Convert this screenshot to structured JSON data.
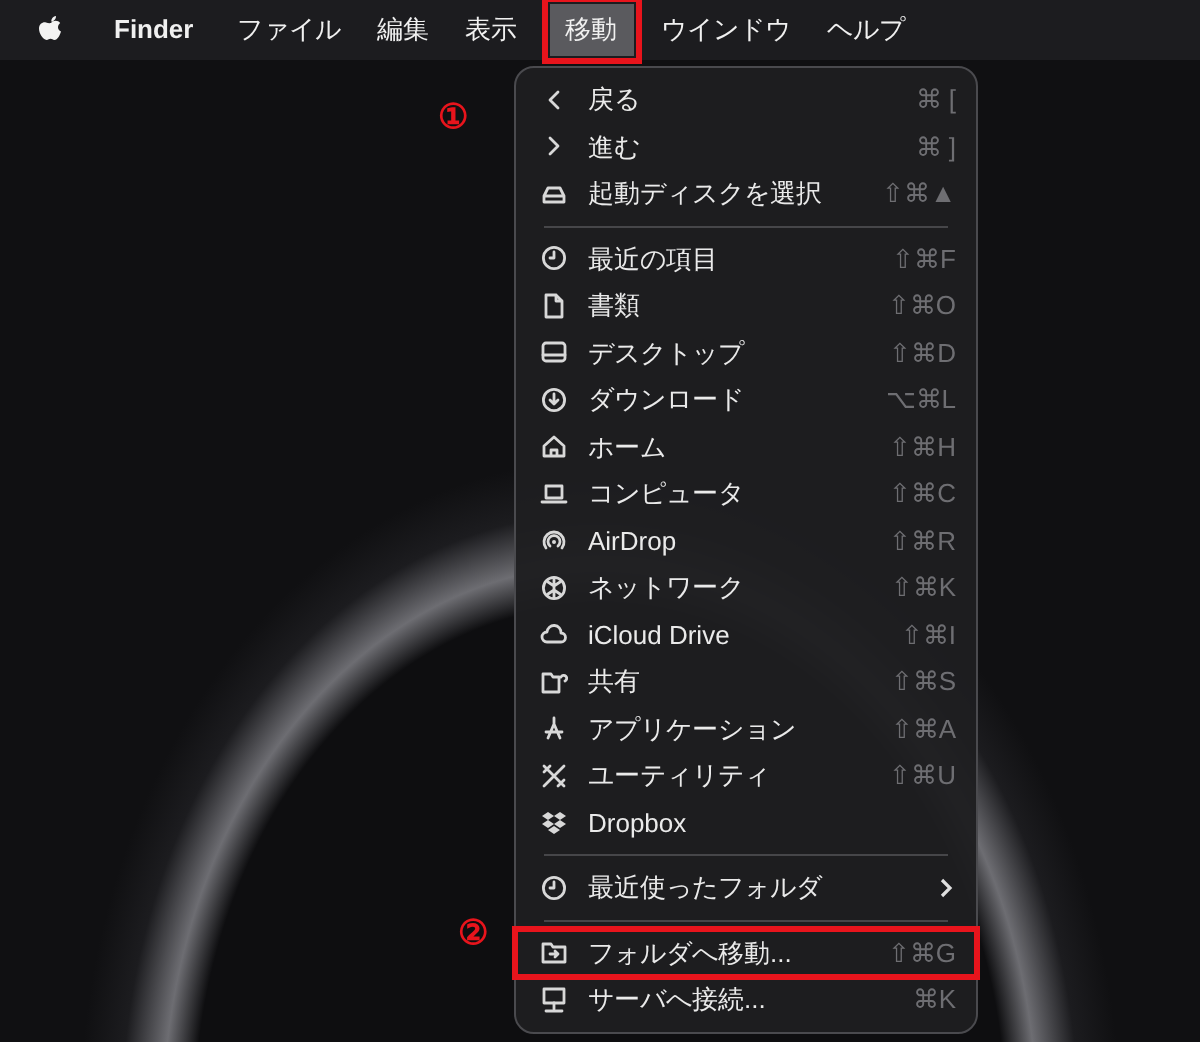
{
  "menubar": {
    "items": [
      {
        "label": "Finder",
        "selected": false,
        "app": true,
        "highlighted": false
      },
      {
        "label": "ファイル",
        "selected": false,
        "app": false,
        "highlighted": false
      },
      {
        "label": "編集",
        "selected": false,
        "app": false,
        "highlighted": false
      },
      {
        "label": "表示",
        "selected": false,
        "app": false,
        "highlighted": false
      },
      {
        "label": "移動",
        "selected": true,
        "app": false,
        "highlighted": true,
        "callout": "①"
      },
      {
        "label": "ウインドウ",
        "selected": false,
        "app": false,
        "highlighted": false
      },
      {
        "label": "ヘルプ",
        "selected": false,
        "app": false,
        "highlighted": false
      }
    ]
  },
  "menu": {
    "sections": [
      {
        "items": [
          {
            "label": "戻る",
            "shortcut": "⌘ [",
            "submenu": false,
            "highlighted": false
          },
          {
            "label": "進む",
            "shortcut": "⌘ ]",
            "submenu": false,
            "highlighted": false
          },
          {
            "label": "起動ディスクを選択",
            "shortcut": "⇧⌘▲",
            "submenu": false,
            "highlighted": false
          }
        ]
      },
      {
        "items": [
          {
            "label": "最近の項目",
            "shortcut": "⇧⌘F",
            "submenu": false,
            "highlighted": false
          },
          {
            "label": "書類",
            "shortcut": "⇧⌘O",
            "submenu": false,
            "highlighted": false
          },
          {
            "label": "デスクトップ",
            "shortcut": "⇧⌘D",
            "submenu": false,
            "highlighted": false
          },
          {
            "label": "ダウンロード",
            "shortcut": "⌥⌘L",
            "submenu": false,
            "highlighted": false
          },
          {
            "label": "ホーム",
            "shortcut": "⇧⌘H",
            "submenu": false,
            "highlighted": false
          },
          {
            "label": "コンピュータ",
            "shortcut": "⇧⌘C",
            "submenu": false,
            "highlighted": false
          },
          {
            "label": "AirDrop",
            "shortcut": "⇧⌘R",
            "submenu": false,
            "highlighted": false
          },
          {
            "label": "ネットワーク",
            "shortcut": "⇧⌘K",
            "submenu": false,
            "highlighted": false
          },
          {
            "label": "iCloud Drive",
            "shortcut": "⇧⌘I",
            "submenu": false,
            "highlighted": false
          },
          {
            "label": "共有",
            "shortcut": "⇧⌘S",
            "submenu": false,
            "highlighted": false
          },
          {
            "label": "アプリケーション",
            "shortcut": "⇧⌘A",
            "submenu": false,
            "highlighted": false
          },
          {
            "label": "ユーティリティ",
            "shortcut": "⇧⌘U",
            "submenu": false,
            "highlighted": false
          },
          {
            "label": "Dropbox",
            "submenu": false,
            "highlighted": false
          }
        ]
      },
      {
        "items": [
          {
            "label": "最近使ったフォルダ",
            "submenu": true,
            "highlighted": false
          }
        ]
      },
      {
        "items": [
          {
            "label": "フォルダへ移動...",
            "shortcut": "⇧⌘G",
            "submenu": false,
            "highlighted": true,
            "callout": "②"
          },
          {
            "label": "サーバへ接続...",
            "shortcut": "⌘K",
            "submenu": false,
            "highlighted": false
          }
        ]
      }
    ]
  }
}
